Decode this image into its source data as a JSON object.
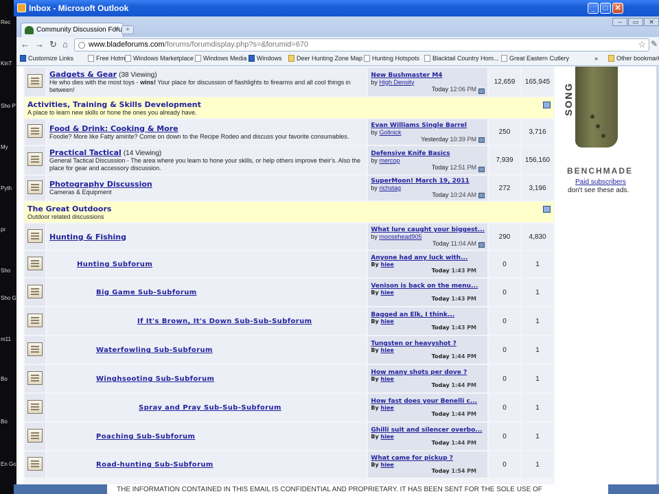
{
  "outlook": {
    "title": "Inbox - Microsoft Outlook"
  },
  "desktop": {
    "labels": [
      "Rec",
      "KinT",
      "Sho Pulse",
      "My",
      "Pyth",
      "pr",
      "Sho",
      "Sho GALA",
      "m11",
      "Bo",
      "Bo",
      "En Goo"
    ]
  },
  "browser": {
    "tab_title": "Community Discussion Foru...",
    "url_host": "www.bladeforums.com",
    "url_path": "/forums/forumdisplay.php?s=&forumid=670",
    "bookmarks": [
      "Customize Links",
      "Free Hotmail",
      "Windows Marketplace",
      "Windows Media",
      "Windows",
      "Deer Hunting Zone Map",
      "Hunting Hotspots",
      "Blacktail Country Hom...",
      "Great Eastern Cutlery"
    ],
    "other_bookmarks": "Other bookmarks"
  },
  "top_forum": {
    "name": "Gadgets & Gear",
    "viewing": "(38 Viewing)",
    "desc_pre": "He who dies with the most toys - ",
    "desc_bold": "wins!",
    "desc_post": " Your place for discussion of flashlights to firearms and all cool things in between!",
    "lp_title": "New Bushmaster M4",
    "lp_by": "by",
    "lp_user": "High Density",
    "lp_day": "Today",
    "lp_time": "12:06 PM",
    "threads": "12,659",
    "posts": "165,945"
  },
  "cat1": {
    "title": "Activities, Training & Skills Development",
    "desc": "A place to learn new skills or hone the ones you already have."
  },
  "cat1_forums": [
    {
      "name": "Food & Drink: Cooking & More",
      "viewing": "",
      "desc": "Foodie? More like Fatty amirite? Come on down to the Recipe Rodeo and discuss your favorite consumables.",
      "lp_title": "Evan Williams Single Barrel",
      "lp_by": "by",
      "lp_user": "Gollnick",
      "lp_day": "Yesterday",
      "lp_time": "10:39 PM",
      "threads": "250",
      "posts": "3,716"
    },
    {
      "name": "Practical Tactical",
      "viewing": "(14 Viewing)",
      "desc": "General Tactical Discussion - The area where you learn to hone your skills, or help others improve their's. Also the place for gear and accessory discussion.",
      "lp_title": "Defensive Knife Basics",
      "lp_by": "by",
      "lp_user": "mercop",
      "lp_day": "Today",
      "lp_time": "12:51 PM",
      "threads": "7,939",
      "posts": "156,160"
    },
    {
      "name": "Photography Discussion",
      "viewing": "",
      "desc": "Cameras & Equipment",
      "lp_title": "SuperMoon! March 19, 2011",
      "lp_by": "by",
      "lp_user": "richstag",
      "lp_day": "Today",
      "lp_time": "10:24 AM",
      "threads": "272",
      "posts": "3,196"
    }
  ],
  "cat2": {
    "title": "The Great Outdoors",
    "desc": "Outdoor related discussions"
  },
  "hunting": {
    "name": "Hunting & Fishing",
    "lp_title": "What lure caught your biggest...",
    "lp_by": "by",
    "lp_user": "moosehead905",
    "lp_day": "Today",
    "lp_time": "11:04 AM",
    "threads": "290",
    "posts": "4,830"
  },
  "subforums": [
    {
      "name": "Hunting Subforum",
      "lp_title": "Anyone had any luck with...",
      "lp_by": "By",
      "lp_user": "hiee",
      "lp_day": "Today",
      "lp_time": "1:43 PM",
      "threads": "0",
      "posts": "1"
    },
    {
      "name": "Big Game Sub-Subforum",
      "lp_title": "Venison is back on the menu...",
      "lp_by": "By",
      "lp_user": "hiee",
      "lp_day": "Today",
      "lp_time": "1:43 PM",
      "threads": "0",
      "posts": "1"
    },
    {
      "name": "If It's Brown, It's Down Sub-Sub-Subforum",
      "lp_title": "Bagged an Elk, I think...",
      "lp_by": "By",
      "lp_user": "hiee",
      "lp_day": "Today",
      "lp_time": "1:43 PM",
      "threads": "0",
      "posts": "1"
    },
    {
      "name": "Waterfowling Sub-Subforum",
      "lp_title": "Tungsten or heavyshot ?",
      "lp_by": "By",
      "lp_user": "hiee",
      "lp_day": "Today",
      "lp_time": "1:44 PM",
      "threads": "0",
      "posts": "1"
    },
    {
      "name": "Winghsooting Sub-Subforum",
      "lp_title": "How many shots per dove ?",
      "lp_by": "By",
      "lp_user": "hiee",
      "lp_day": "Today",
      "lp_time": "1:44 PM",
      "threads": "0",
      "posts": "1"
    },
    {
      "name": "Spray and Pray Sub-Sub-Subforum",
      "lp_title": "How fast does your Benelli c...",
      "lp_by": "By",
      "lp_user": "hiee",
      "lp_day": "Today",
      "lp_time": "1:44 PM",
      "threads": "0",
      "posts": "1"
    },
    {
      "name": "Poaching Sub-Subforum",
      "lp_title": "Ghilli suit and silencer overbo...",
      "lp_by": "By",
      "lp_user": "hiee",
      "lp_day": "Today",
      "lp_time": "1:44 PM",
      "threads": "0",
      "posts": "1"
    },
    {
      "name": "Road-hunting Sub-Subforum",
      "lp_title": "What came for pickup ?",
      "lp_by": "By",
      "lp_user": "hiee",
      "lp_day": "Today",
      "lp_time": "1:54 PM",
      "threads": "0",
      "posts": "1"
    }
  ],
  "ad": {
    "side_text": "SONG",
    "brand": "BENCHMADE",
    "paid_link": "Paid subscribers",
    "dont_see": "don't see these ads."
  },
  "footer_text": "THE INFORMATION CONTAINED IN THIS EMAIL IS CONFIDENTIAL AND PROPRIETARY. IT HAS BEEN SENT FOR THE SOLE USE OF"
}
